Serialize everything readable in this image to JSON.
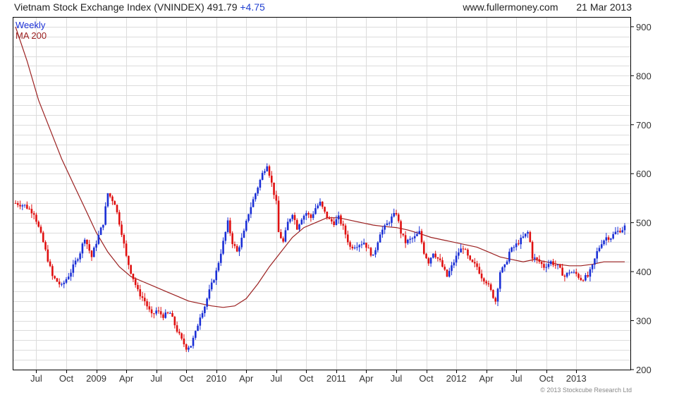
{
  "header": {
    "title": "Vietnam Stock Exchange Index (VNINDEX)",
    "last": "491.79",
    "change": "+4.75",
    "site": "www.fullermoney.com",
    "date": "21 Mar 2013"
  },
  "credit": "© 2013 Stockcube Research Ltd",
  "colors": {
    "up": "#1a2fd6",
    "down": "#e01010",
    "ma": "#9b2020",
    "frame": "#000000",
    "grid": "#dcdcdc"
  },
  "chart_data": {
    "type": "candlestick",
    "title": "Vietnam Stock Exchange Index (VNINDEX)",
    "period": "Weekly",
    "ylim": [
      200,
      920
    ],
    "yticks": [
      200,
      300,
      400,
      500,
      600,
      700,
      800,
      900
    ],
    "x_ticks": [
      "Jul",
      "Oct",
      "2009",
      "Apr",
      "Jul",
      "Oct",
      "2010",
      "Apr",
      "Jul",
      "Oct",
      "2011",
      "Apr",
      "Jul",
      "Oct",
      "2012",
      "Apr",
      "Jul",
      "Oct",
      "2013"
    ],
    "legend": [
      {
        "label": "Weekly",
        "color": "#1a2fd6"
      },
      {
        "label": "MA 200",
        "color": "#9b2020"
      }
    ],
    "series": [
      {
        "name": "Weekly",
        "kind": "close",
        "points": [
          [
            0,
            540
          ],
          [
            4,
            535
          ],
          [
            8,
            520
          ],
          [
            12,
            460
          ],
          [
            16,
            390
          ],
          [
            20,
            370
          ],
          [
            24,
            400
          ],
          [
            28,
            440
          ],
          [
            30,
            470
          ],
          [
            33,
            430
          ],
          [
            35,
            460
          ],
          [
            38,
            500
          ],
          [
            40,
            560
          ],
          [
            43,
            540
          ],
          [
            46,
            480
          ],
          [
            48,
            430
          ],
          [
            50,
            400
          ],
          [
            53,
            360
          ],
          [
            56,
            340
          ],
          [
            59,
            310
          ],
          [
            61,
            320
          ],
          [
            64,
            310
          ],
          [
            67,
            315
          ],
          [
            70,
            280
          ],
          [
            72,
            260
          ],
          [
            74,
            245
          ],
          [
            76,
            250
          ],
          [
            78,
            275
          ],
          [
            80,
            310
          ],
          [
            82,
            330
          ],
          [
            84,
            360
          ],
          [
            87,
            400
          ],
          [
            90,
            460
          ],
          [
            92,
            500
          ],
          [
            94,
            460
          ],
          [
            96,
            440
          ],
          [
            99,
            480
          ],
          [
            101,
            520
          ],
          [
            104,
            560
          ],
          [
            107,
            600
          ],
          [
            109,
            620
          ],
          [
            111,
            580
          ],
          [
            113,
            540
          ],
          [
            114,
            480
          ],
          [
            116,
            460
          ],
          [
            118,
            500
          ],
          [
            120,
            520
          ],
          [
            122,
            490
          ],
          [
            124,
            510
          ],
          [
            126,
            520
          ],
          [
            128,
            510
          ],
          [
            130,
            530
          ],
          [
            132,
            540
          ],
          [
            134,
            520
          ],
          [
            136,
            505
          ],
          [
            138,
            500
          ],
          [
            140,
            510
          ],
          [
            142,
            490
          ],
          [
            145,
            450
          ],
          [
            148,
            455
          ],
          [
            151,
            460
          ],
          [
            153,
            445
          ],
          [
            155,
            430
          ],
          [
            158,
            480
          ],
          [
            160,
            490
          ],
          [
            163,
            510
          ],
          [
            165,
            520
          ],
          [
            167,
            480
          ],
          [
            169,
            460
          ],
          [
            171,
            465
          ],
          [
            173,
            470
          ],
          [
            175,
            480
          ],
          [
            177,
            440
          ],
          [
            179,
            420
          ],
          [
            181,
            440
          ],
          [
            184,
            420
          ],
          [
            187,
            390
          ],
          [
            190,
            420
          ],
          [
            192,
            440
          ],
          [
            194,
            450
          ],
          [
            197,
            420
          ],
          [
            200,
            410
          ],
          [
            202,
            390
          ],
          [
            204,
            380
          ],
          [
            206,
            360
          ],
          [
            208,
            340
          ],
          [
            210,
            400
          ],
          [
            212,
            410
          ],
          [
            214,
            440
          ],
          [
            216,
            450
          ],
          [
            218,
            460
          ],
          [
            220,
            470
          ],
          [
            222,
            480
          ],
          [
            223,
            460
          ],
          [
            224,
            430
          ],
          [
            227,
            420
          ],
          [
            229,
            410
          ],
          [
            232,
            420
          ],
          [
            235,
            410
          ],
          [
            238,
            390
          ],
          [
            240,
            400
          ],
          [
            243,
            395
          ],
          [
            245,
            385
          ],
          [
            248,
            390
          ],
          [
            250,
            410
          ],
          [
            252,
            440
          ],
          [
            254,
            460
          ],
          [
            256,
            470
          ],
          [
            258,
            470
          ],
          [
            260,
            480
          ],
          [
            261,
            482
          ],
          [
            262,
            485
          ],
          [
            263,
            487
          ],
          [
            264,
            491.79
          ]
        ]
      },
      {
        "name": "MA 200",
        "kind": "line",
        "points": [
          [
            0,
            900
          ],
          [
            5,
            830
          ],
          [
            10,
            750
          ],
          [
            15,
            690
          ],
          [
            20,
            630
          ],
          [
            25,
            580
          ],
          [
            30,
            530
          ],
          [
            35,
            480
          ],
          [
            40,
            440
          ],
          [
            45,
            410
          ],
          [
            50,
            390
          ],
          [
            55,
            380
          ],
          [
            60,
            370
          ],
          [
            65,
            360
          ],
          [
            70,
            350
          ],
          [
            75,
            340
          ],
          [
            80,
            335
          ],
          [
            85,
            330
          ],
          [
            90,
            327
          ],
          [
            95,
            330
          ],
          [
            100,
            345
          ],
          [
            105,
            375
          ],
          [
            110,
            410
          ],
          [
            115,
            440
          ],
          [
            120,
            470
          ],
          [
            125,
            490
          ],
          [
            130,
            500
          ],
          [
            135,
            510
          ],
          [
            140,
            510
          ],
          [
            145,
            505
          ],
          [
            150,
            500
          ],
          [
            155,
            495
          ],
          [
            160,
            492
          ],
          [
            165,
            490
          ],
          [
            170,
            485
          ],
          [
            175,
            478
          ],
          [
            180,
            470
          ],
          [
            185,
            465
          ],
          [
            190,
            460
          ],
          [
            195,
            455
          ],
          [
            200,
            450
          ],
          [
            205,
            440
          ],
          [
            210,
            430
          ],
          [
            215,
            425
          ],
          [
            220,
            420
          ],
          [
            225,
            425
          ],
          [
            230,
            420
          ],
          [
            235,
            415
          ],
          [
            240,
            412
          ],
          [
            245,
            412
          ],
          [
            250,
            415
          ],
          [
            255,
            420
          ],
          [
            260,
            420
          ],
          [
            264,
            420
          ]
        ]
      }
    ]
  }
}
